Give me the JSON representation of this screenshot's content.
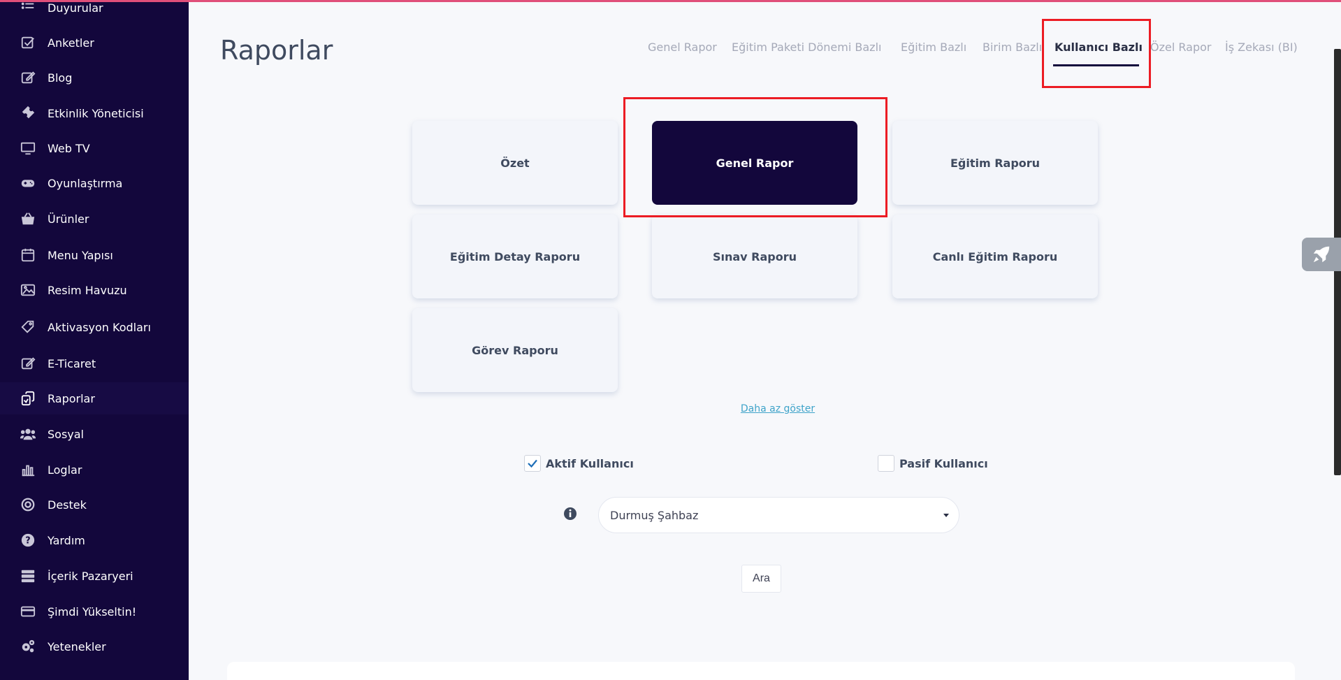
{
  "sidebar": {
    "items": [
      {
        "label": "Duyurular",
        "icon": "list-icon"
      },
      {
        "label": "Anketler",
        "icon": "checkbox-icon"
      },
      {
        "label": "Blog",
        "icon": "edit-icon"
      },
      {
        "label": "Etkinlik Yöneticisi",
        "icon": "ticket-icon"
      },
      {
        "label": "Web TV",
        "icon": "monitor-icon"
      },
      {
        "label": "Oyunlaştırma",
        "icon": "gamepad-icon"
      },
      {
        "label": "Ürünler",
        "icon": "basket-icon"
      },
      {
        "label": "Menu Yapısı",
        "icon": "calendar-icon"
      },
      {
        "label": "Resim Havuzu",
        "icon": "image-icon"
      },
      {
        "label": "Aktivasyon Kodları",
        "icon": "tag-icon"
      },
      {
        "label": "E-Ticaret",
        "icon": "edit-icon"
      },
      {
        "label": "Raporlar",
        "icon": "reports-icon"
      },
      {
        "label": "Sosyal",
        "icon": "users-icon"
      },
      {
        "label": "Loglar",
        "icon": "bar-chart-icon"
      },
      {
        "label": "Destek",
        "icon": "lifebuoy-icon"
      },
      {
        "label": "Yardım",
        "icon": "question-icon"
      },
      {
        "label": "İçerik Pazaryeri",
        "icon": "server-icon"
      },
      {
        "label": "Şimdi Yükseltin!",
        "icon": "credit-card-icon"
      },
      {
        "label": "Yetenekler",
        "icon": "gears-icon"
      }
    ],
    "active": "Raporlar"
  },
  "page": {
    "title": "Raporlar"
  },
  "tabs": [
    {
      "label": "Genel Rapor"
    },
    {
      "label": "Eğitim Paketi Dönemi Bazlı"
    },
    {
      "label": "Eğitim Bazlı"
    },
    {
      "label": "Birim Bazlı"
    },
    {
      "label": "Kullanıcı Bazlı"
    },
    {
      "label": "Özel Rapor"
    },
    {
      "label": "İş Zekası (BI)"
    }
  ],
  "active_tab": "Kullanıcı Bazlı",
  "report_cards": [
    {
      "label": "Özet"
    },
    {
      "label": "Genel Rapor"
    },
    {
      "label": "Eğitim Raporu"
    },
    {
      "label": "Eğitim Detay Raporu"
    },
    {
      "label": "Sınav Raporu"
    },
    {
      "label": "Canlı Eğitim Raporu"
    },
    {
      "label": "Görev Raporu"
    }
  ],
  "selected_card": "Genel Rapor",
  "show_less_label": "Daha az göster",
  "filters": {
    "active_user": {
      "label": "Aktif Kullanıcı",
      "checked": true
    },
    "passive_user": {
      "label": "Pasif Kullanıcı",
      "checked": false
    }
  },
  "user_select": {
    "value": "Durmuş Şahbaz"
  },
  "search_button": {
    "label": "Ara"
  },
  "colors": {
    "sidebar_bg": "#13073c",
    "selected_card_bg": "#13073c",
    "highlight_box": "#ec1c24",
    "link": "#3ea3c9",
    "top_accent": "#e04f7a"
  }
}
